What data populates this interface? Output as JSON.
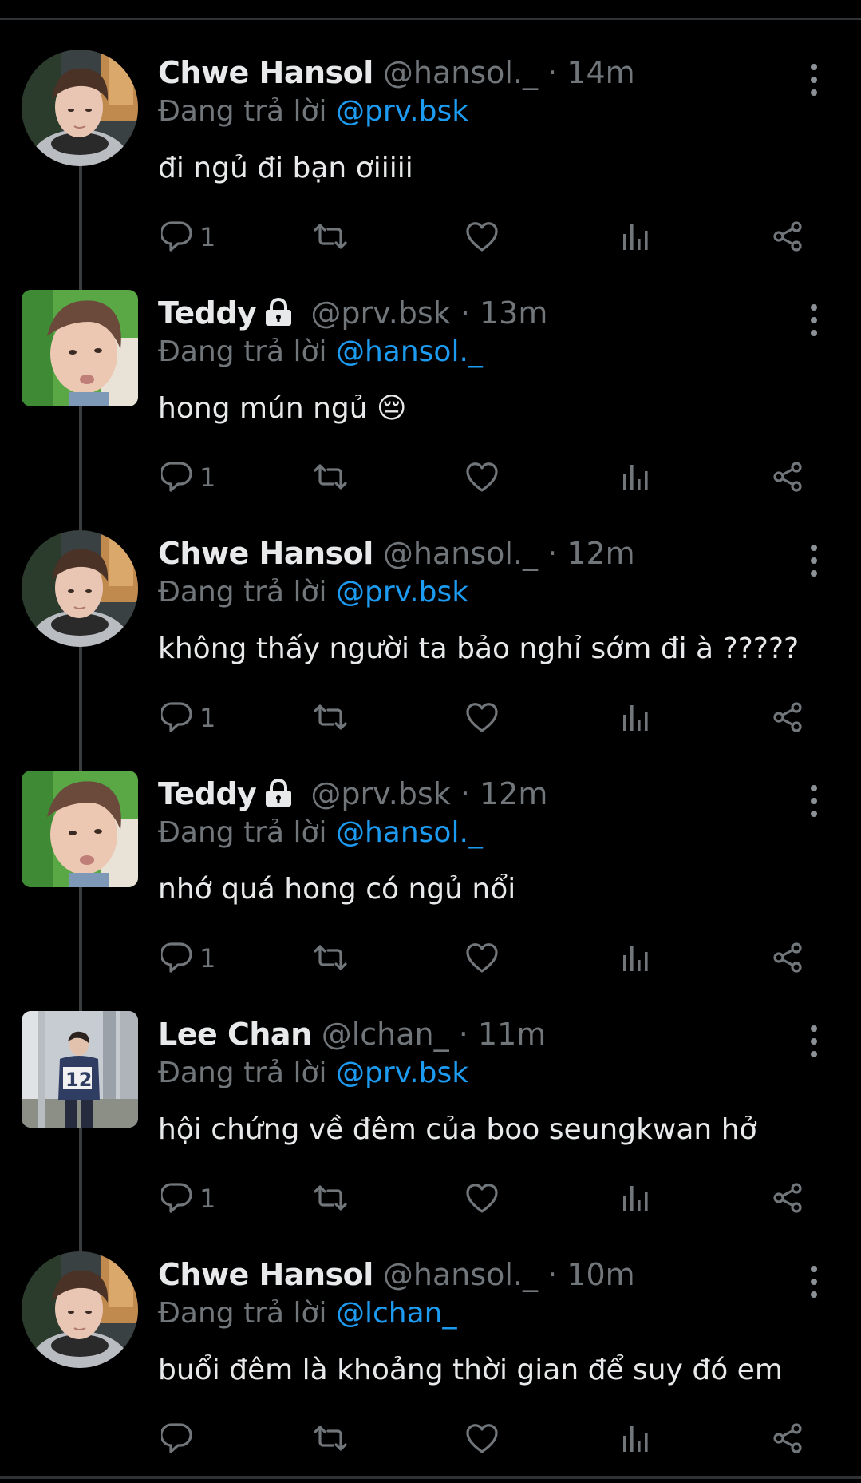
{
  "tweets": [
    {
      "name": "Chwe Hansol",
      "handle": "@hansol._",
      "sep": "·",
      "time": "14m",
      "replying_prefix": "Đang trả lời",
      "replying_to": "@prv.bsk",
      "text": "đi ngủ đi bạn ơiiiii",
      "reply_count": "1",
      "locked": false,
      "avatar": "hansol"
    },
    {
      "name": "Teddy",
      "handle": "@prv.bsk",
      "sep": "·",
      "time": "13m",
      "replying_prefix": "Đang trả lời",
      "replying_to": "@hansol._",
      "text": "hong mún ngủ 😔",
      "reply_count": "1",
      "locked": true,
      "avatar": "teddy"
    },
    {
      "name": "Chwe Hansol",
      "handle": "@hansol._",
      "sep": "·",
      "time": "12m",
      "replying_prefix": "Đang trả lời",
      "replying_to": "@prv.bsk",
      "text": "không thấy người ta bảo nghỉ sớm đi à ?????",
      "reply_count": "1",
      "locked": false,
      "avatar": "hansol"
    },
    {
      "name": "Teddy",
      "handle": "@prv.bsk",
      "sep": "·",
      "time": "12m",
      "replying_prefix": "Đang trả lời",
      "replying_to": "@hansol._",
      "text": "nhớ quá hong có ngủ nổi",
      "reply_count": "1",
      "locked": true,
      "avatar": "teddy"
    },
    {
      "name": "Lee Chan",
      "handle": "@lchan_",
      "sep": "·",
      "time": "11m",
      "replying_prefix": "Đang trả lời",
      "replying_to": "@prv.bsk",
      "text": "hội chứng về đêm của boo seungkwan hở",
      "reply_count": "1",
      "locked": false,
      "avatar": "leechan"
    },
    {
      "name": "Chwe Hansol",
      "handle": "@hansol._",
      "sep": "·",
      "time": "10m",
      "replying_prefix": "Đang trả lời",
      "replying_to": "@lchan_",
      "text": "buổi đêm là khoảng thời gian để suy đó em",
      "reply_count": "",
      "locked": false,
      "avatar": "hansol"
    }
  ],
  "icons": {
    "reply": "reply-icon",
    "retweet": "retweet-icon",
    "like": "heart-icon",
    "views": "views-icon",
    "share": "share-icon",
    "more": "more-icon",
    "lock": "lock-icon"
  },
  "colors": {
    "background": "#000000",
    "text": "#e7e9ea",
    "muted": "#71767b",
    "mention": "#1d9bf0"
  }
}
